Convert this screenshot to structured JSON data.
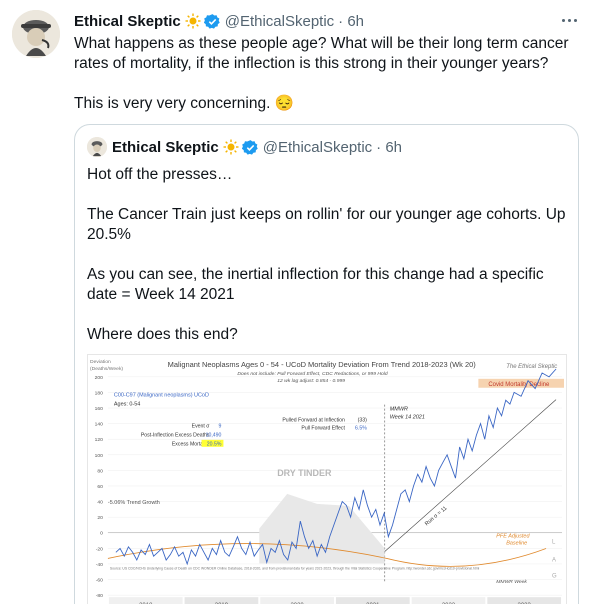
{
  "tweet": {
    "name": "Ethical Skeptic",
    "handle": "@EthicalSkeptic",
    "time": "· 6h",
    "paragraphs": [
      "What happens as these people age? What will be their long term cancer rates of mortality, if the inflection is this strong in their younger years?",
      "This is very very concerning. 😔"
    ]
  },
  "quoted": {
    "name": "Ethical Skeptic",
    "handle": "@EthicalSkeptic",
    "time": "· 6h",
    "paragraphs": [
      "Hot off the presses…",
      "The Cancer Train just keeps on rollin' for our younger age cohorts. Up 20.5%",
      "As you can see, the inertial inflection for this change had a specific date = Week 14 2021",
      "Where does this end?"
    ]
  },
  "chart": {
    "title": "Malignant Neoplasms Ages 0 - 54 - UCoD Mortality Deviation From Trend  2018-2023 (Wk 20)",
    "subtitle1": "Does not include: Pull Forward Effect,  CDC Redactions, or 999 Hold",
    "subtitle2": "12 wk lag adjust: 0.854 - 0.999",
    "watermark": "The Ethical Skeptic",
    "ylabel1": "Deviation",
    "ylabel2": "(Deaths/Week)",
    "box_title": "C00-C97 (Malignant neoplasms) UCoD",
    "box_ages": "Ages: 0-54",
    "stats": [
      {
        "label": "Event σ",
        "value": "9"
      },
      {
        "label": "Post-Inflection Excess Deaths",
        "value": "10,490"
      },
      {
        "label": "Excess Mortality",
        "value": "20.5%"
      }
    ],
    "pull1_label": "Pulled Forward at Inflection",
    "pull1_value": "(33)",
    "pull2_label": "Pull Forward Effect",
    "pull2_value": "6.5%",
    "mmwr": "MMWR",
    "mmwr_week": "Week 14 2021",
    "dry_tinder": "DRY TINDER",
    "trend_growth": "-5.06% Trend Growth",
    "run": "Run σ = 11",
    "covid_decline": "Covid Mortality Decline",
    "pfe1": "PFE Adjusted",
    "pfe2": "Baseline",
    "lag": [
      "L",
      "A",
      "G"
    ],
    "source": "Source: US CDC/NCHS Underlying Cause of Death on CDC WONDER Online Database, 2018-2020, and from provisional data for years 2021-2023, through the Vital Statistics Cooperative Program. http://wonder.cdc.gov/mcd-icd10-provisional.html",
    "mmwr_week_label": "MMWR Week",
    "colors": {
      "line": "#3a66c4",
      "trend": "#8a8a8a",
      "pfe": "#e08a2e",
      "highlight": "#ffff33",
      "covid": "#f6d3b0"
    }
  },
  "chart_data": {
    "type": "line",
    "y_ticks": [
      "200",
      "180",
      "160",
      "140",
      "120",
      "100",
      "80",
      "60",
      "40",
      "20",
      "0",
      "-20",
      "-40",
      "-60",
      "-80"
    ],
    "x_ticks": [
      "2018",
      "2019",
      "2020",
      "2021",
      "2022",
      "2023"
    ],
    "ylim": [
      -80,
      200
    ],
    "series": [
      {
        "name": "C00-C97 (Malignant neoplasms) UCoD",
        "x": [
          0,
          3,
          6,
          9,
          12,
          15,
          18,
          21,
          24,
          27,
          30,
          33,
          36,
          39,
          42,
          45,
          48,
          51,
          54,
          57,
          60,
          63,
          66,
          69,
          72,
          75,
          78,
          81,
          84,
          87,
          90,
          93,
          96,
          99,
          102,
          105,
          108,
          111,
          114,
          117,
          120,
          123,
          126,
          129,
          132,
          135,
          138,
          141,
          144,
          147,
          150,
          153,
          156,
          159,
          162,
          165,
          168,
          171,
          174,
          177,
          180,
          183,
          186,
          189,
          192,
          195,
          198,
          201,
          204,
          207,
          210,
          213,
          216,
          219,
          222,
          225,
          228,
          231,
          234,
          237,
          240,
          243,
          246,
          249,
          252,
          255,
          258,
          261,
          264,
          267,
          270,
          273,
          276,
          279,
          282,
          285,
          290,
          295,
          300,
          305,
          310,
          315
        ],
        "y": [
          -25,
          -20,
          -30,
          -18,
          -25,
          -35,
          -22,
          -28,
          -15,
          -30,
          -25,
          -20,
          -35,
          -28,
          -18,
          -30,
          -25,
          -40,
          -22,
          -30,
          -15,
          -25,
          -35,
          -20,
          -28,
          -10,
          -25,
          -30,
          -18,
          -5,
          -20,
          -28,
          -12,
          -30,
          -22,
          -15,
          -38,
          -20,
          -25,
          -10,
          -28,
          -35,
          -12,
          -20,
          15,
          -5,
          -20,
          -10,
          -30,
          -15,
          -25,
          -5,
          10,
          25,
          40,
          35,
          20,
          45,
          30,
          55,
          35,
          20,
          30,
          10,
          25,
          -5,
          10,
          30,
          50,
          55,
          40,
          60,
          75,
          65,
          85,
          70,
          60,
          80,
          90,
          100,
          85,
          70,
          110,
          95,
          120,
          105,
          125,
          140,
          120,
          150,
          135,
          160,
          150,
          170,
          165,
          180,
          175,
          195,
          185,
          205,
          200,
          210
        ],
        "color": "#3a66c4"
      }
    ]
  }
}
